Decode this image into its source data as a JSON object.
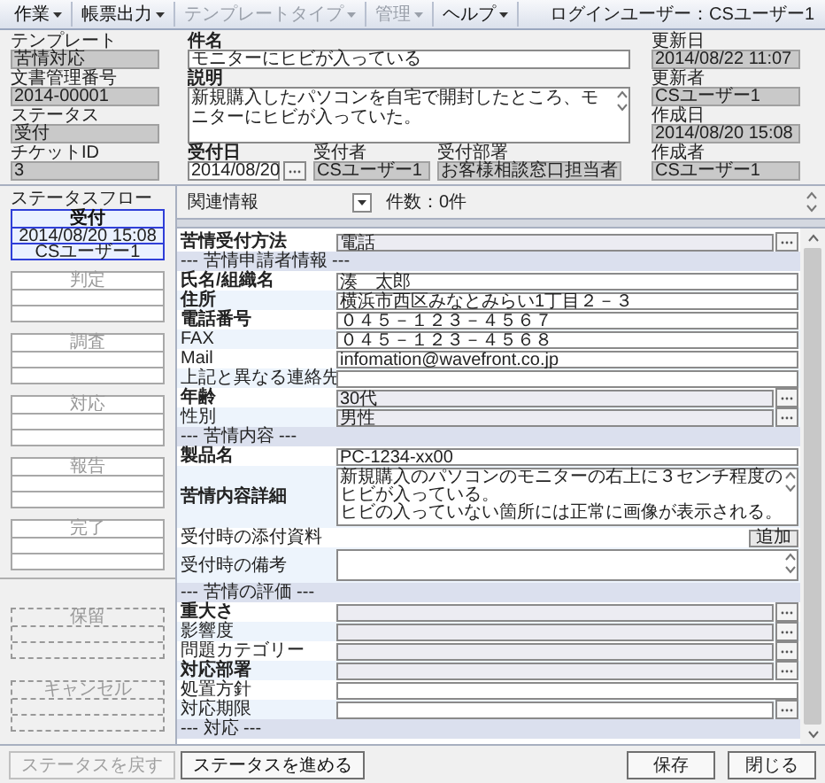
{
  "menu": [
    {
      "label": "作業",
      "disabled": false
    },
    {
      "label": "帳票出力",
      "disabled": false
    },
    {
      "label": "テンプレートタイプ",
      "disabled": true
    },
    {
      "label": "管理",
      "disabled": true
    },
    {
      "label": "ヘルプ",
      "disabled": false
    }
  ],
  "login_user": "ログインユーザー：CSユーザー1",
  "header": {
    "left_fields": [
      {
        "label": "テンプレート",
        "value": "苦情対応"
      },
      {
        "label": "文書管理番号",
        "value": "2014-00001"
      },
      {
        "label": "ステータス",
        "value": "受付"
      },
      {
        "label": "チケットID",
        "value": "3"
      }
    ],
    "subject": {
      "label": "件名",
      "value": "モニターにヒビが入っている"
    },
    "description": {
      "label": "説明",
      "value": "新規購入したパソコンを自宅で開封したところ、モニターにヒビが入っていた。"
    },
    "received_date": {
      "label": "受付日",
      "value": "2014/08/20"
    },
    "receiver": {
      "label": "受付者",
      "value": "CSユーザー1"
    },
    "department": {
      "label": "受付部署",
      "value": "お客様相談窓口担当者"
    },
    "right_fields": [
      {
        "label": "更新日",
        "value": "2014/08/22 11:07"
      },
      {
        "label": "更新者",
        "value": "CSユーザー1"
      },
      {
        "label": "作成日",
        "value": "2014/08/20 15:08"
      },
      {
        "label": "作成者",
        "value": "CSユーザー1"
      }
    ]
  },
  "status_flow": {
    "title": "ステータスフロー",
    "stages": [
      {
        "name": "受付",
        "selected": true,
        "date": "2014/08/20 15:08",
        "user": "CSユーザー1"
      },
      {
        "name": "判定",
        "selected": false
      },
      {
        "name": "調査",
        "selected": false
      },
      {
        "name": "対応",
        "selected": false
      },
      {
        "name": "報告",
        "selected": false
      },
      {
        "name": "完了",
        "selected": false
      }
    ],
    "side_stages": [
      {
        "name": "保留"
      },
      {
        "name": "キャンセル"
      }
    ]
  },
  "related": {
    "label": "関連情報",
    "count": "件数：0件"
  },
  "form_rows": [
    {
      "kind": "select",
      "label": "苦情受付方法",
      "required": true,
      "value": "電話"
    },
    {
      "kind": "section",
      "label": "--- 苦情申請者情報 ---"
    },
    {
      "kind": "text",
      "label": "氏名/組織名",
      "required": true,
      "value": "湊　太郎"
    },
    {
      "kind": "text",
      "label": "住所",
      "required": true,
      "value": "横浜市西区みなとみらい1丁目２－３"
    },
    {
      "kind": "text",
      "label": "電話番号",
      "required": true,
      "value": "０４５－１２３－４５６７"
    },
    {
      "kind": "text",
      "label": "FAX",
      "required": false,
      "value": "０４５－１２３－４５６８"
    },
    {
      "kind": "text",
      "label": "Mail",
      "required": false,
      "value": "infomation@wavefront.co.jp"
    },
    {
      "kind": "text",
      "label": "上記と異なる連絡先",
      "required": false
    },
    {
      "kind": "select",
      "label": "年齢",
      "required": true,
      "value": "30代"
    },
    {
      "kind": "select",
      "label": "性別",
      "required": false,
      "value": "男性"
    },
    {
      "kind": "section",
      "label": "--- 苦情内容 ---"
    },
    {
      "kind": "text",
      "label": "製品名",
      "required": true,
      "value": "PC-1234-xx00"
    },
    {
      "kind": "textarea",
      "label": "苦情内容詳細",
      "required": true,
      "lines": [
        "新規購入のパソコンのモニターの右上に３センチ程度のヒビが入っている。",
        "ヒビの入っていない箇所には正常に画像が表示される。"
      ]
    },
    {
      "kind": "attachment",
      "label": "受付時の添付資料",
      "required": false,
      "button": "追加"
    },
    {
      "kind": "textarea",
      "label": "受付時の備考",
      "required": false
    },
    {
      "kind": "section",
      "label": "--- 苦情の評価 ---"
    },
    {
      "kind": "select",
      "label": "重大さ",
      "required": true
    },
    {
      "kind": "select",
      "label": "影響度",
      "required": false
    },
    {
      "kind": "select",
      "label": "問題カテゴリー",
      "required": false
    },
    {
      "kind": "select",
      "label": "対応部署",
      "required": true
    },
    {
      "kind": "text",
      "label": "処置方針",
      "required": false
    },
    {
      "kind": "date",
      "label": "対応期限",
      "required": false
    },
    {
      "kind": "section",
      "label": "--- 対応 ---"
    }
  ],
  "footer": {
    "status_buttons": [
      {
        "label": "ステータスを戻す",
        "disabled": true
      },
      {
        "label": "ステータスを進める",
        "disabled": false
      }
    ],
    "actions": [
      "保存",
      "閉じる"
    ]
  }
}
